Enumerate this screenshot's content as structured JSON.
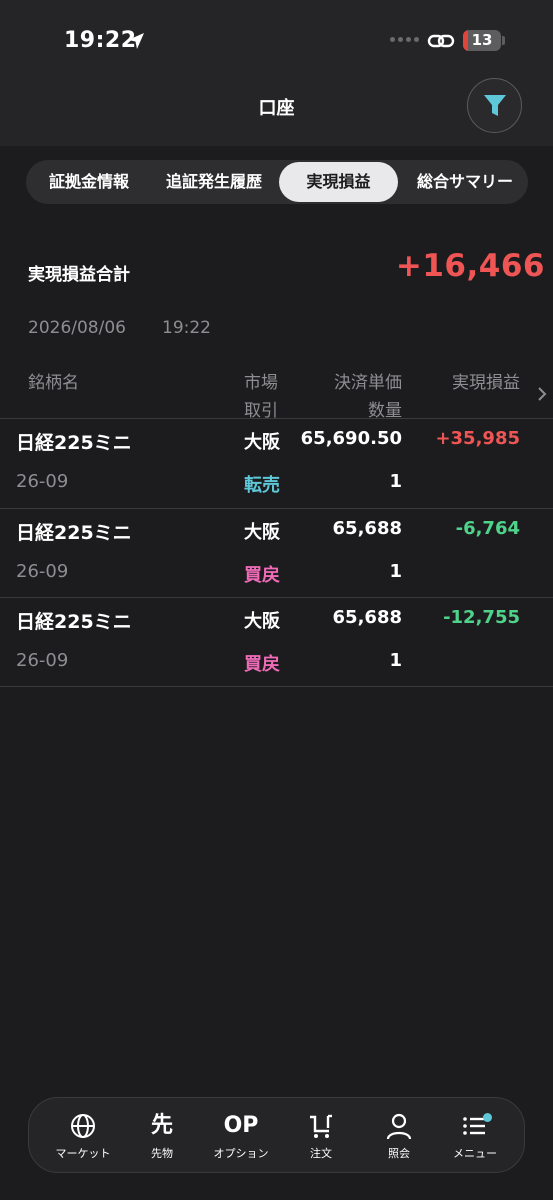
{
  "status_bar": {
    "time": "19:22",
    "battery": "13",
    "battery_level": 0.13
  },
  "header": {
    "title": "口座"
  },
  "tabs": [
    {
      "label": "証拠金情報",
      "active": false
    },
    {
      "label": "追証発生履歴",
      "active": false
    },
    {
      "label": "実現損益",
      "active": true
    },
    {
      "label": "総合サマリー",
      "active": false
    }
  ],
  "summary": {
    "label": "実現損益合計",
    "value": "+16,466",
    "date": "2026/08/06",
    "time": "19:22"
  },
  "table": {
    "headers": {
      "name": "銘柄名",
      "market": "市場",
      "trade": "取引",
      "price": "決済単価",
      "qty": "数量",
      "pl": "実現損益"
    },
    "rows": [
      {
        "name": "日経225ミニ",
        "code": "26-09",
        "market": "大阪",
        "type": "転売",
        "price": "65,690.50",
        "qty": "1",
        "pl": "+35,985"
      },
      {
        "name": "日経225ミニ",
        "code": "26-09",
        "market": "大阪",
        "type": "買戻",
        "price": "65,688",
        "qty": "1",
        "pl": "-6,764"
      },
      {
        "name": "日経225ミニ",
        "code": "26-09",
        "market": "大阪",
        "type": "買戻",
        "price": "65,688",
        "qty": "1",
        "pl": "-12,755"
      }
    ]
  },
  "bottom_nav": [
    {
      "label": "マーケット",
      "icon": "globe-icon"
    },
    {
      "label": "先物",
      "icon_text": "先"
    },
    {
      "label": "オプション",
      "icon_text": "OP"
    },
    {
      "label": "注文",
      "icon": "cart-icon"
    },
    {
      "label": "照会",
      "icon": "person-icon"
    },
    {
      "label": "メニュー",
      "icon": "menu-icon"
    }
  ],
  "colors": {
    "background": "#1c1c1e",
    "positive": "#f05555",
    "negative": "#4fd38a",
    "resell": "#5ec8d8",
    "buyback": "#f06bb8",
    "accent": "#5ec8d8"
  }
}
